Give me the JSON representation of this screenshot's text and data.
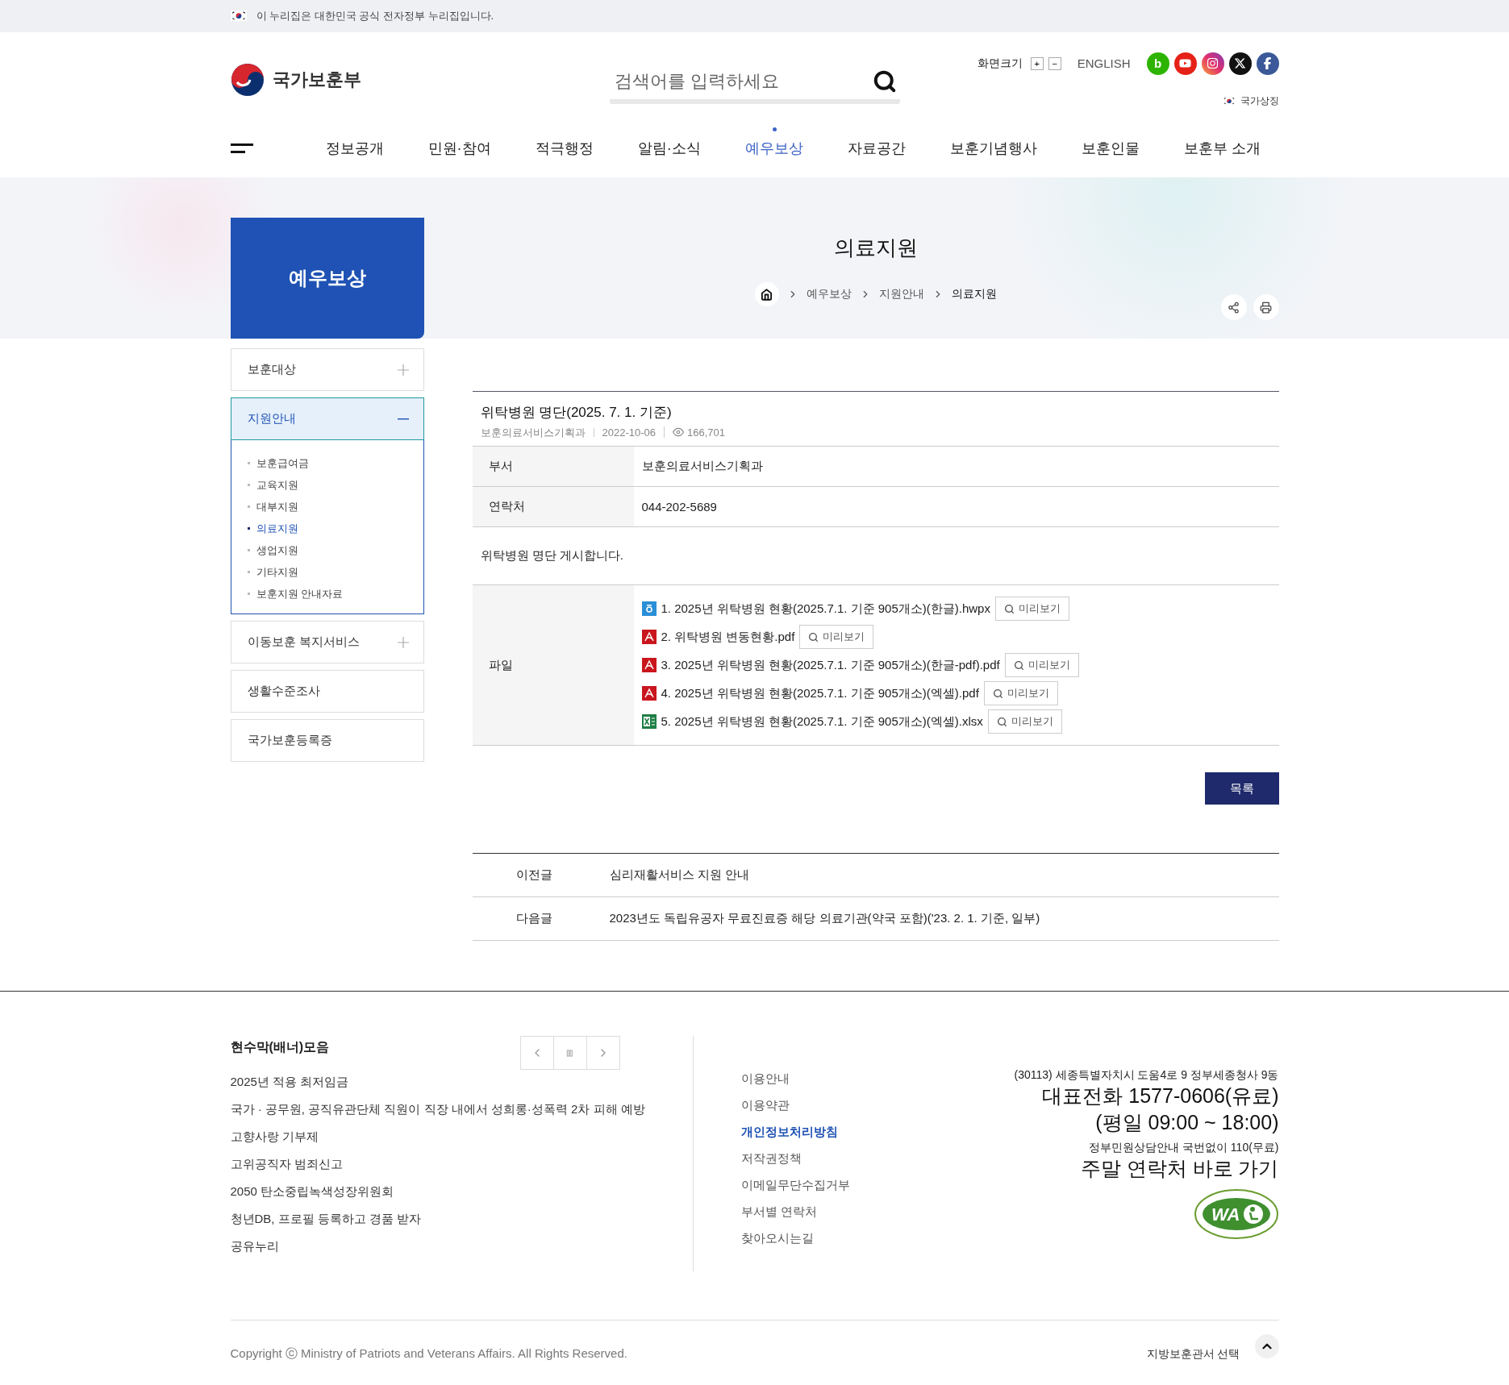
{
  "gov_banner": {
    "text": "이 누리집은 대한민국 공식 전자정부 누리집입니다."
  },
  "header": {
    "logo": "국가보훈부",
    "search": {
      "placeholder": "검색어를 입력하세요"
    },
    "font_size": {
      "label": "화면크기",
      "buttons": [
        "+",
        "−"
      ]
    },
    "language": "ENGLISH",
    "social": [
      {
        "kind": "blog",
        "label": "b"
      },
      {
        "kind": "youtube"
      },
      {
        "kind": "instagram"
      },
      {
        "kind": "x"
      },
      {
        "kind": "facebook"
      }
    ],
    "national_symbol": "국가상징"
  },
  "nav": [
    {
      "label": "정보공개",
      "selected": false
    },
    {
      "label": "민원·참여",
      "selected": false
    },
    {
      "label": "적극행정",
      "selected": false
    },
    {
      "label": "알림·소식",
      "selected": false
    },
    {
      "label": "예우보상",
      "selected": true
    },
    {
      "label": "자료공간",
      "selected": false
    },
    {
      "label": "보훈기념행사",
      "selected": false
    },
    {
      "label": "보훈인물",
      "selected": false
    },
    {
      "label": "보훈부 소개",
      "selected": false
    }
  ],
  "section_title": "예우보상",
  "page_title": "의료지원",
  "breadcrumb": [
    "예우보상",
    "지원안내",
    "의료지원"
  ],
  "sidebar": [
    {
      "label": "보훈대상",
      "kind": "group",
      "expanded": false
    },
    {
      "label": "지원안내",
      "kind": "group",
      "expanded": true,
      "children": [
        {
          "label": "보훈급여금",
          "selected": false
        },
        {
          "label": "교육지원",
          "selected": false
        },
        {
          "label": "대부지원",
          "selected": false
        },
        {
          "label": "의료지원",
          "selected": true
        },
        {
          "label": "생업지원",
          "selected": false
        },
        {
          "label": "기타지원",
          "selected": false
        },
        {
          "label": "보훈지원 안내자료",
          "selected": false
        }
      ]
    },
    {
      "label": "이동보훈 복지서비스",
      "kind": "group",
      "expanded": false
    },
    {
      "label": "생활수준조사",
      "kind": "link"
    },
    {
      "label": "국가보훈등록증",
      "kind": "link"
    }
  ],
  "post": {
    "title": "위탁병원 명단(2025. 7. 1. 기준)",
    "department": "보훈의료서비스기획과",
    "date": "2022-10-06",
    "views": "166,701",
    "fields": [
      {
        "label": "부서",
        "value": "보훈의료서비스기획과"
      },
      {
        "label": "연락처",
        "value": "044-202-5689"
      }
    ],
    "body": "위탁병원 명단 게시합니다.",
    "files_label": "파일",
    "files": [
      {
        "kind": "hwp",
        "name": "1. 2025년 위탁병원 현황(2025.7.1. 기준 905개소)(한글).hwpx",
        "preview": "미리보기"
      },
      {
        "kind": "pdf",
        "name": "2. 위탁병원 변동현황.pdf",
        "preview": "미리보기"
      },
      {
        "kind": "pdf",
        "name": "3. 2025년 위탁병원 현황(2025.7.1. 기준 905개소)(한글-pdf).pdf",
        "preview": "미리보기"
      },
      {
        "kind": "pdf",
        "name": "4. 2025년 위탁병원 현황(2025.7.1. 기준 905개소)(엑셀).pdf",
        "preview": "미리보기"
      },
      {
        "kind": "xlsx",
        "name": "5. 2025년 위탁병원 현황(2025.7.1. 기준 905개소)(엑셀).xlsx",
        "preview": "미리보기"
      }
    ]
  },
  "list_button": "목록",
  "adjacent": [
    {
      "label": "이전글",
      "title": "심리재활서비스 지원 안내"
    },
    {
      "label": "다음글",
      "title": "2023년도 독립유공자 무료진료증 해당 의료기관(약국 포함)('23. 2. 1. 기준, 일부)"
    }
  ],
  "footer": {
    "banner_title": "현수막(배너)모음",
    "banners": [
      "2025년 적용 최저임금",
      "국가 · 공무원, 공직유관단체 직원이 직장 내에서 성희롱·성폭력 2차 피해 예방",
      "고향사랑 기부제",
      "고위공직자 범죄신고",
      "2050 탄소중립녹색성장위원회",
      "청년DB, 프로필 등록하고 경품 받자",
      "공유누리"
    ],
    "links": [
      {
        "label": "이용안내",
        "emphasized": false
      },
      {
        "label": "이용약관",
        "emphasized": false
      },
      {
        "label": "개인정보처리방침",
        "emphasized": true
      },
      {
        "label": "저작권정책",
        "emphasized": false
      },
      {
        "label": "이메일무단수집거부",
        "emphasized": false
      },
      {
        "label": "부서별 연락처",
        "emphasized": false
      },
      {
        "label": "찾아오시는길",
        "emphasized": false
      }
    ],
    "address": "(30113) 세종특별자치시 도움4로 9 정부세종청사 9동",
    "phone": "대표전화 1577-0606(유료)",
    "hours": "(평일 09:00 ~ 18:00)",
    "hotline": "정부민원상담안내 국번없이 110(무료)",
    "weekend": "주말 연락처 바로 가기",
    "wa_mark": "WA",
    "copyright": "Copyright ⓒ Ministry of Patriots and Veterans Affairs. All Rights Reserved.",
    "office_select": "지방보훈관서 선택"
  }
}
